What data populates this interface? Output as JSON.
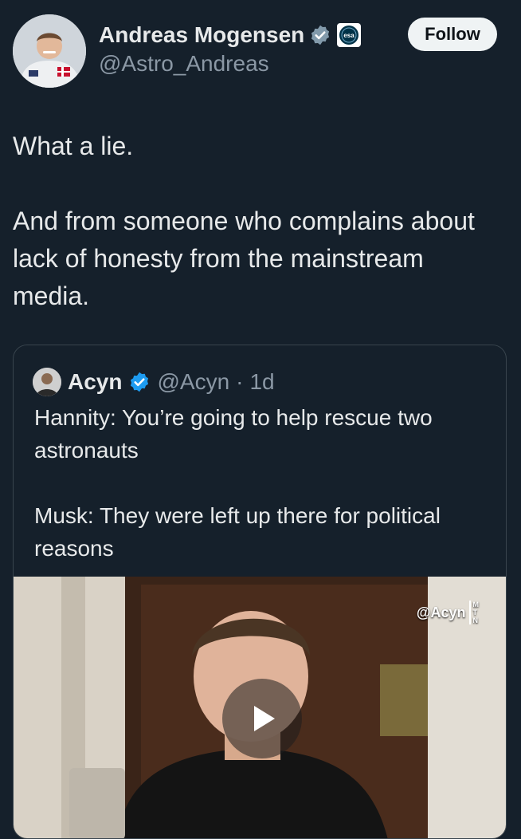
{
  "author": {
    "name": "Andreas Mogensen",
    "handle": "@Astro_Andreas",
    "avatar_icon": "astronaut-avatar",
    "verified_icon": "gray-verified-badge-icon",
    "org_icon": "esa-logo-icon",
    "org_label": "esa"
  },
  "follow_button": {
    "label": "Follow"
  },
  "tweet": {
    "paragraphs": [
      "What a lie.",
      "And from someone who complains about lack of honesty from the mainstream media."
    ]
  },
  "quoted_tweet": {
    "name": "Acyn",
    "handle": "@Acyn",
    "separator": "·",
    "time": "1d",
    "verified_icon": "blue-verified-badge-icon",
    "paragraphs": [
      "Hannity: You’re going to help rescue two astronauts",
      "Musk: They were left up there for political reasons"
    ],
    "media": {
      "watermark": "@Acyn",
      "watermark_logo": [
        "M",
        "T",
        "N"
      ],
      "play_icon": "play-icon"
    }
  },
  "colors": {
    "background": "#15202b",
    "text": "#e7e9ea",
    "secondary_text": "#8b98a5",
    "verified_blue": "#1d9bf0",
    "verified_gray": "#829aab",
    "border": "#38444d"
  }
}
